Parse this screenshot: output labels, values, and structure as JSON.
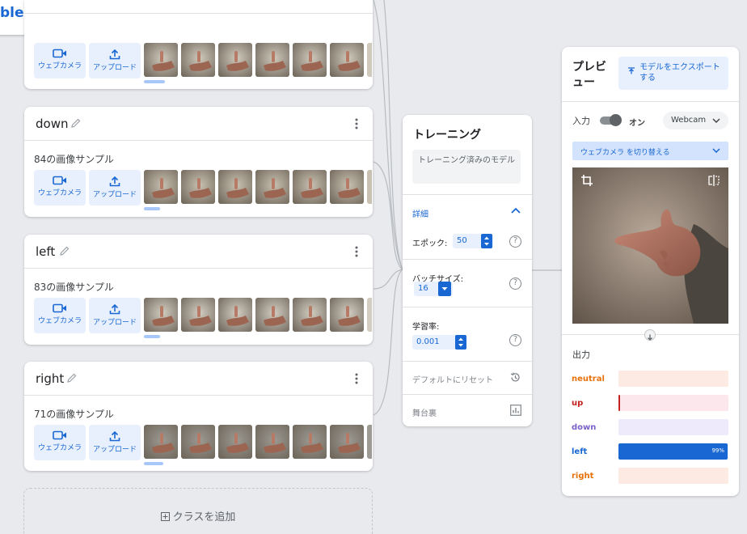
{
  "app": {
    "logo_text": "ble Machine"
  },
  "classes": [
    {
      "name": "",
      "sample_text": "",
      "webcam_label": "ウェブカメラ",
      "upload_label": "アップロード",
      "thumb_tone": "#cfc9bc"
    },
    {
      "name": "down",
      "sample_text": "84の画像サンプル",
      "webcam_label": "ウェブカメラ",
      "upload_label": "アップロード",
      "thumb_tone": "#c8c0b0"
    },
    {
      "name": "left",
      "sample_text": "83の画像サンプル",
      "webcam_label": "ウェブカメラ",
      "upload_label": "アップロード",
      "thumb_tone": "#d3cdc1"
    },
    {
      "name": "right",
      "sample_text": "71の画像サンプル",
      "webcam_label": "ウェブカメラ",
      "upload_label": "アップロード",
      "thumb_tone": "#9c9a93"
    }
  ],
  "add_class_label": "クラスを追加",
  "training": {
    "title": "トレーニング",
    "train_button": "トレーニング済みのモデル",
    "advanced_label": "詳細",
    "epochs_label": "エポック:",
    "epochs_value": "50",
    "batch_label": "バッチサイズ:",
    "batch_value": "16",
    "lr_label": "学習率:",
    "lr_value": "0.001",
    "reset_label": "デフォルトにリセット",
    "under_hood_label": "舞台裏"
  },
  "preview": {
    "title": "プレビュー",
    "export_label": "モデルをエクスポートする",
    "input_label": "入力",
    "toggle_state": "オン",
    "source_select": "Webcam",
    "switch_label": "ウェブカメラ を切り替える",
    "output_label": "出力",
    "outputs": [
      {
        "label": "neutral",
        "color": "#e8710a",
        "bg": "#fdeae3",
        "fill": 0
      },
      {
        "label": "up",
        "color": "#c5221f",
        "bg": "#fce8ec",
        "fill": 0.01
      },
      {
        "label": "down",
        "color": "#7b61c9",
        "bg": "#eeeafb",
        "fill": 0
      },
      {
        "label": "left",
        "color": "#1967d2",
        "bg": "#e8f0fe",
        "fill": 0.99,
        "pct_text": "99%"
      },
      {
        "label": "right",
        "color": "#e8710a",
        "bg": "#fdeae3",
        "fill": 0
      }
    ]
  }
}
